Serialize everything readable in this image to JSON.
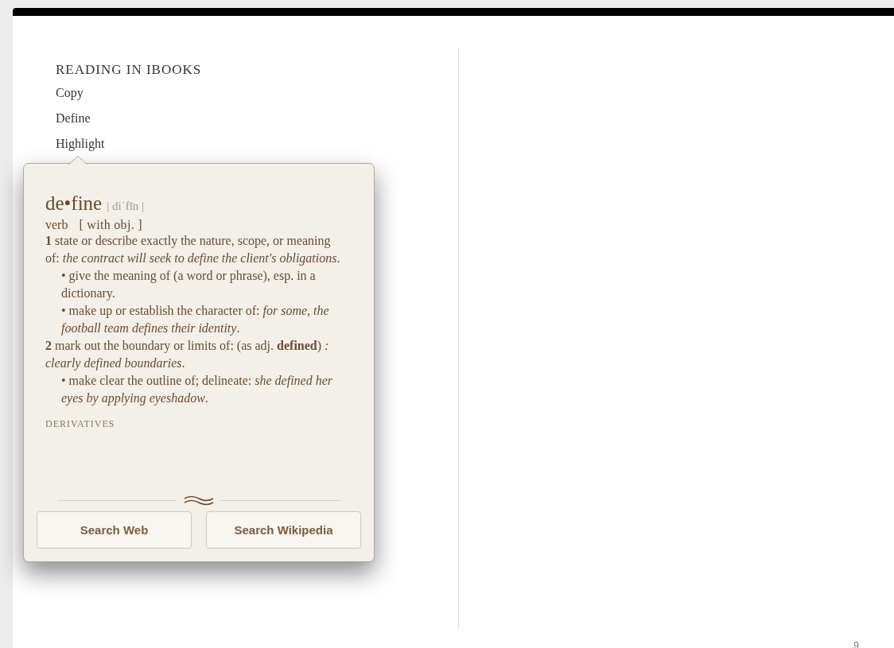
{
  "page": {
    "heading": "READING IN IBOOKS",
    "items": [
      "Copy",
      "Define",
      "Highlight"
    ],
    "page_number": "9"
  },
  "popover": {
    "headword": "de•fine",
    "pronunciation": "| diˈfīn |",
    "grammar": [
      {
        "kind": "pos",
        "text": "verb"
      },
      {
        "kind": "note",
        "text": "[ with obj. ]"
      }
    ],
    "senses": [
      {
        "kind": "numbered",
        "number": "1",
        "text": "state or describe exactly the nature, scope, or meaning of: *the contract will seek to define the client's obligations*."
      },
      {
        "kind": "bullet",
        "text": "• give the meaning of (a word or phrase), esp. in a dictionary."
      },
      {
        "kind": "bullet",
        "text": "• make up or establish the character of: *for some, the football team defines their identity*."
      },
      {
        "kind": "numbered",
        "number": "2",
        "text": "mark out the boundary or limits of: (as adj. **defined**) *: clearly defined boundaries*."
      },
      {
        "kind": "bullet",
        "text": "• make clear the outline of; delineate: *she defined her eyes by applying eyeshadow*."
      }
    ],
    "section": "DERIVATIVES",
    "buttons": [
      "Search Web",
      "Search Wikipedia"
    ]
  }
}
